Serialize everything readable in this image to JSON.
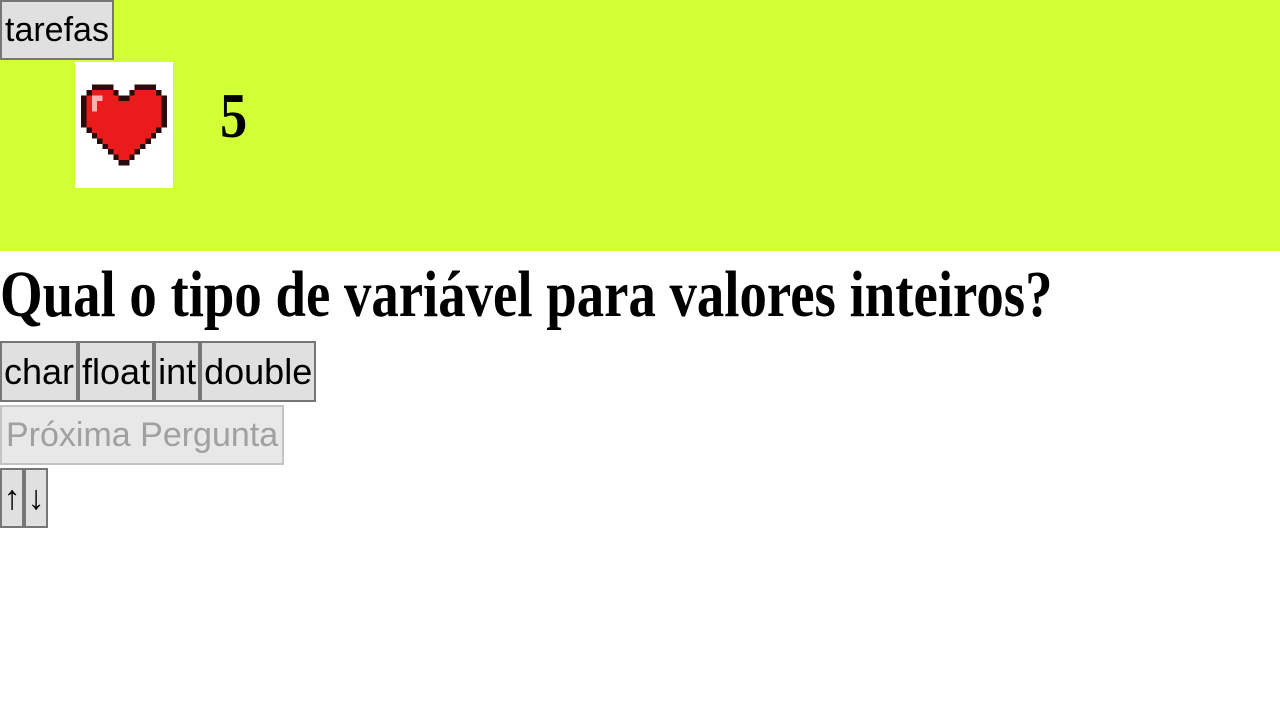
{
  "header": {
    "tasks_label": "tarefas",
    "lives": "5",
    "heart_icon": "heart-icon",
    "background_color": "#d2ff36"
  },
  "quiz": {
    "question": "Qual o tipo de variável para valores inteiros?",
    "answers": [
      "char",
      "float",
      "int",
      "double"
    ],
    "next_label": "Próxima Pergunta"
  },
  "controls": {
    "up_label": "↑",
    "down_label": "↓"
  }
}
